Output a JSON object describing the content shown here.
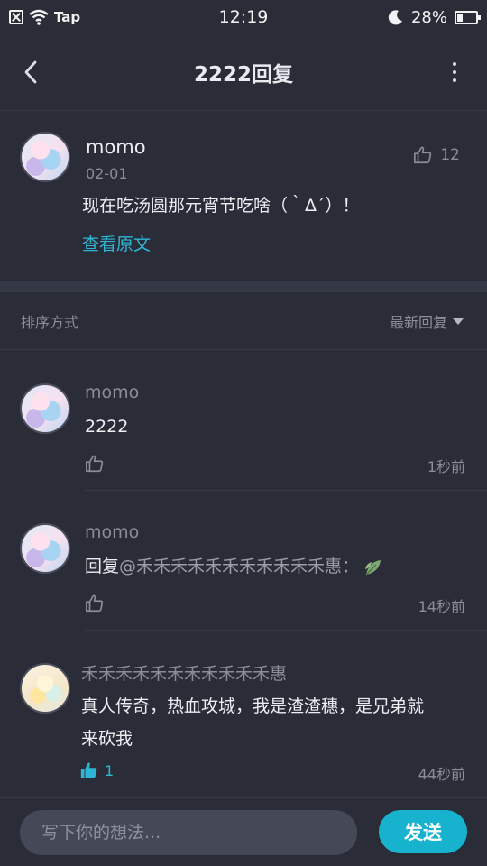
{
  "status_bar": {
    "app_indicator": "Tap",
    "time": "12:19",
    "battery_percent": "28%",
    "battery_level": 0.28
  },
  "header": {
    "title": "2222回复"
  },
  "original_comment": {
    "author": "momo",
    "date": "02-01",
    "like_count": "12",
    "text": "现在吃汤圆那元宵节吃啥（｀Δ´）！",
    "view_original_label": "查看原文"
  },
  "sort": {
    "label": "排序方式",
    "selected": "最新回复"
  },
  "replies": [
    {
      "author": "momo",
      "text": "2222",
      "time": "1秒前",
      "like_count": ""
    },
    {
      "author": "momo",
      "text_prefix": "回复",
      "mention": "@禾禾禾禾禾禾禾禾禾禾禾惠：",
      "time": "14秒前",
      "like_count": ""
    },
    {
      "author": "禾禾禾禾禾禾禾禾禾禾禾惠",
      "text_line1": "真人传奇，热血攻城，我是渣渣穗，是兄弟就",
      "text_line2": "来砍我",
      "time": "44秒前",
      "like_count": "1"
    }
  ],
  "composer": {
    "placeholder": "写下你的想法...",
    "send_label": "发送"
  },
  "colors": {
    "background": "#2a2d38",
    "accent": "#17b2cd",
    "link": "#2fb6d6",
    "muted_text": "#8a8d98"
  }
}
